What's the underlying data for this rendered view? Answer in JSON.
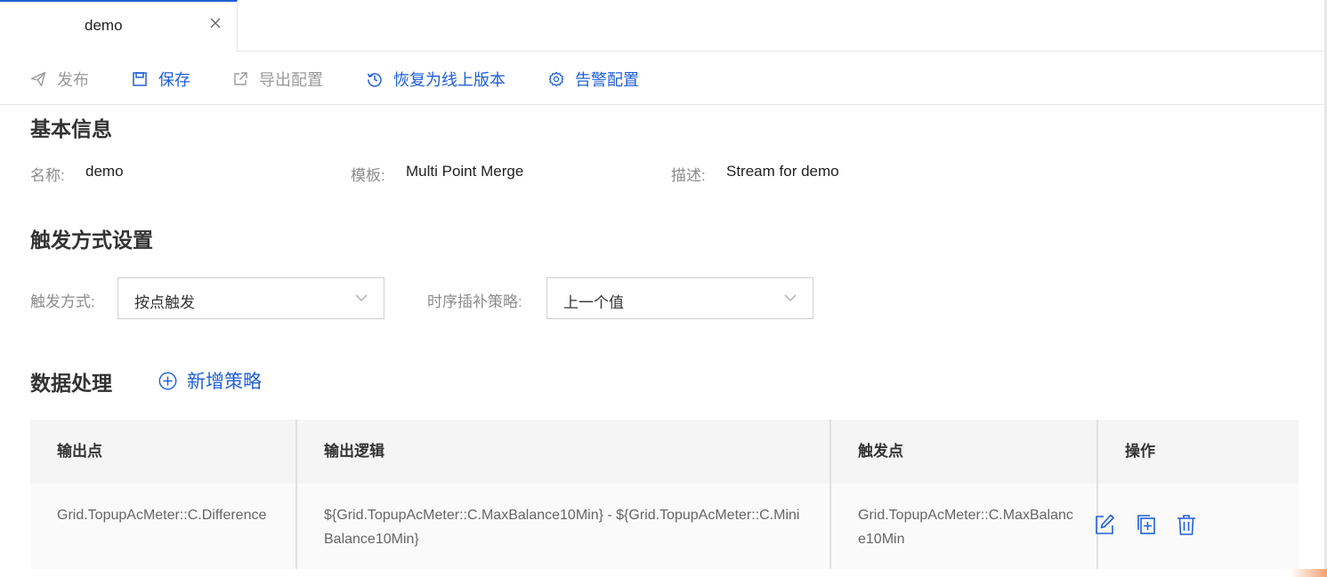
{
  "tab": {
    "label": "demo"
  },
  "toolbar": {
    "publish": "发布",
    "save": "保存",
    "export": "导出配置",
    "restore": "恢复为线上版本",
    "alarm": "告警配置"
  },
  "basic_info": {
    "title": "基本信息",
    "name_label": "名称:",
    "name_value": "demo",
    "template_label": "模板:",
    "template_value": "Multi Point Merge",
    "desc_label": "描述:",
    "desc_value": "Stream for demo"
  },
  "trigger": {
    "title": "触发方式设置",
    "mode_label": "触发方式:",
    "mode_value": "按点触发",
    "fill_label": "时序插补策略:",
    "fill_value": "上一个值"
  },
  "data_processing": {
    "title": "数据处理",
    "add_label": "新增策略",
    "columns": [
      "输出点",
      "输出逻辑",
      "触发点",
      "操作"
    ],
    "rows": [
      {
        "output_point": "Grid.TopupAcMeter::C.Difference",
        "output_logic": "${Grid.TopupAcMeter::C.MaxBalance10Min} - ${Grid.TopupAcMeter::C.MiniBalance10Min}",
        "trigger_point": "Grid.TopupAcMeter::C.MaxBalance10Min"
      }
    ]
  },
  "colors": {
    "primary": "#1f5fd6",
    "muted": "#9a9a9a",
    "header_bg": "#f5f5f5"
  }
}
